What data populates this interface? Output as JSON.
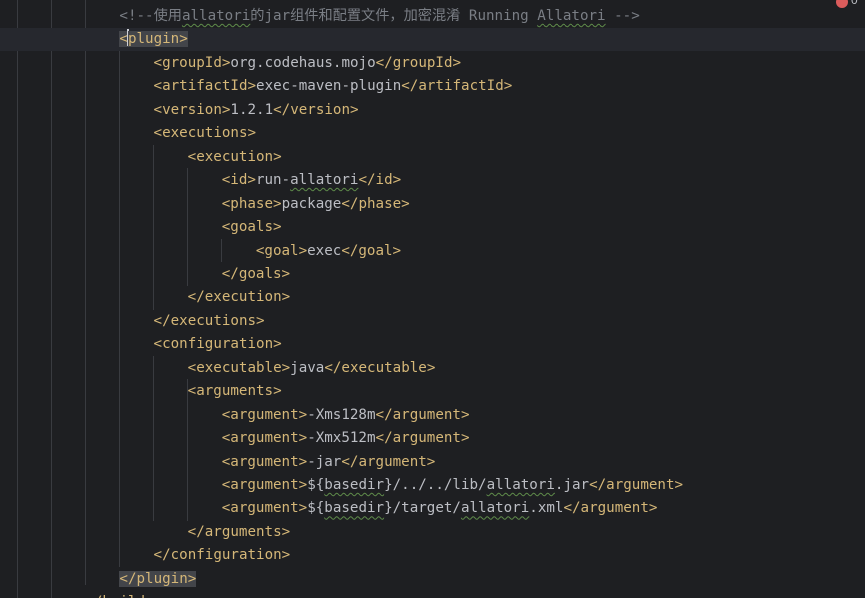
{
  "editor": {
    "language": "xml",
    "inspection_error_count": "0",
    "lines": [
      [
        [
          "cm",
          "<!--使用"
        ],
        [
          "cm",
          "allatori",
          "sq"
        ],
        [
          "cm",
          "的jar组件和配置文件，加密混淆 Running "
        ],
        [
          "cm",
          "Allatori",
          "sq"
        ],
        [
          "cm",
          " -->"
        ]
      ],
      [
        [
          "tagm",
          "<"
        ],
        [
          "caret",
          ""
        ],
        [
          "tagm",
          "plugin>"
        ]
      ],
      [
        [
          "tag",
          "<groupId>"
        ],
        [
          "txt",
          "org.codehaus.mojo"
        ],
        [
          "tag",
          "</groupId>"
        ]
      ],
      [
        [
          "tag",
          "<artifactId>"
        ],
        [
          "txt",
          "exec-maven-plugin"
        ],
        [
          "tag",
          "</artifactId>"
        ]
      ],
      [
        [
          "tag",
          "<version>"
        ],
        [
          "txt",
          "1.2.1"
        ],
        [
          "tag",
          "</version>"
        ]
      ],
      [
        [
          "tag",
          "<executions>"
        ]
      ],
      [
        [
          "tag",
          "<execution>"
        ]
      ],
      [
        [
          "tag",
          "<id>"
        ],
        [
          "txt",
          "run-"
        ],
        [
          "txt",
          "allatori",
          "sq"
        ],
        [
          "tag",
          "</id>"
        ]
      ],
      [
        [
          "tag",
          "<phase>"
        ],
        [
          "txt",
          "package"
        ],
        [
          "tag",
          "</phase>"
        ]
      ],
      [
        [
          "tag",
          "<goals>"
        ]
      ],
      [
        [
          "tag",
          "<goal>"
        ],
        [
          "txt",
          "exec"
        ],
        [
          "tag",
          "</goal>"
        ]
      ],
      [
        [
          "tag",
          "</goals>"
        ]
      ],
      [
        [
          "tag",
          "</execution>"
        ]
      ],
      [
        [
          "tag",
          "</executions>"
        ]
      ],
      [
        [
          "tag",
          "<configuration>"
        ]
      ],
      [
        [
          "tag",
          "<executable>"
        ],
        [
          "txt",
          "java"
        ],
        [
          "tag",
          "</executable>"
        ]
      ],
      [
        [
          "tag",
          "<arguments>"
        ]
      ],
      [
        [
          "tag",
          "<argument>"
        ],
        [
          "txt",
          "-Xms128m"
        ],
        [
          "tag",
          "</argument>"
        ]
      ],
      [
        [
          "tag",
          "<argument>"
        ],
        [
          "txt",
          "-Xmx512m"
        ],
        [
          "tag",
          "</argument>"
        ]
      ],
      [
        [
          "tag",
          "<argument>"
        ],
        [
          "txt",
          "-jar"
        ],
        [
          "tag",
          "</argument>"
        ]
      ],
      [
        [
          "tag",
          "<argument>"
        ],
        [
          "txt",
          "${"
        ],
        [
          "txt",
          "basedir",
          "sq"
        ],
        [
          "txt",
          "}/../../lib/"
        ],
        [
          "txt",
          "allatori",
          "sq"
        ],
        [
          "txt",
          ".jar"
        ],
        [
          "tag",
          "</argument>"
        ]
      ],
      [
        [
          "tag",
          "<argument>"
        ],
        [
          "txt",
          "${"
        ],
        [
          "txt",
          "basedir",
          "sq"
        ],
        [
          "txt",
          "}/target/"
        ],
        [
          "txt",
          "allatori",
          "sq"
        ],
        [
          "txt",
          ".xml"
        ],
        [
          "tag",
          "</argument>"
        ]
      ],
      [
        [
          "tag",
          "</arguments>"
        ]
      ],
      [
        [
          "tag",
          "</configuration>"
        ]
      ],
      [
        [
          "tagm",
          "</plugin>"
        ]
      ],
      [
        [
          "tag",
          "</build>"
        ]
      ]
    ]
  }
}
